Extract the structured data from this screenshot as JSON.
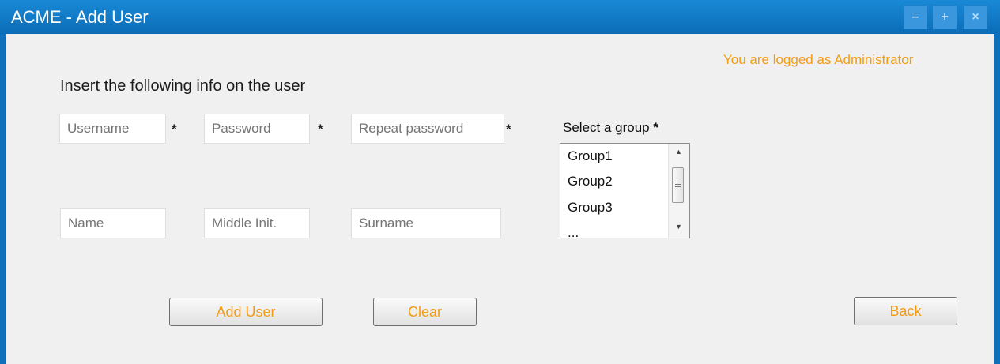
{
  "window": {
    "title": "ACME - Add User",
    "controls": {
      "minimize": "–",
      "maximize": "+",
      "close": "×"
    },
    "colors": {
      "titlebar": "#0e70ba",
      "accent_text": "#f59b12",
      "background": "#f0f0f0"
    }
  },
  "status": {
    "logged_text": "You are logged as Administrator"
  },
  "form": {
    "instruction": "Insert the following info on the user",
    "required_mark": "*",
    "username": {
      "placeholder": "Username",
      "value": ""
    },
    "password": {
      "placeholder": "Password",
      "value": ""
    },
    "repeat_password": {
      "placeholder": "Repeat password",
      "value": ""
    },
    "name": {
      "placeholder": "Name",
      "value": ""
    },
    "middle_init": {
      "placeholder": "Middle Init.",
      "value": ""
    },
    "surname": {
      "placeholder": "Surname",
      "value": ""
    }
  },
  "group_select": {
    "label": "Select a group",
    "options": [
      "Group1",
      "Group2",
      "Group3",
      "..."
    ]
  },
  "buttons": {
    "add_user": "Add User",
    "clear": "Clear",
    "back": "Back"
  }
}
